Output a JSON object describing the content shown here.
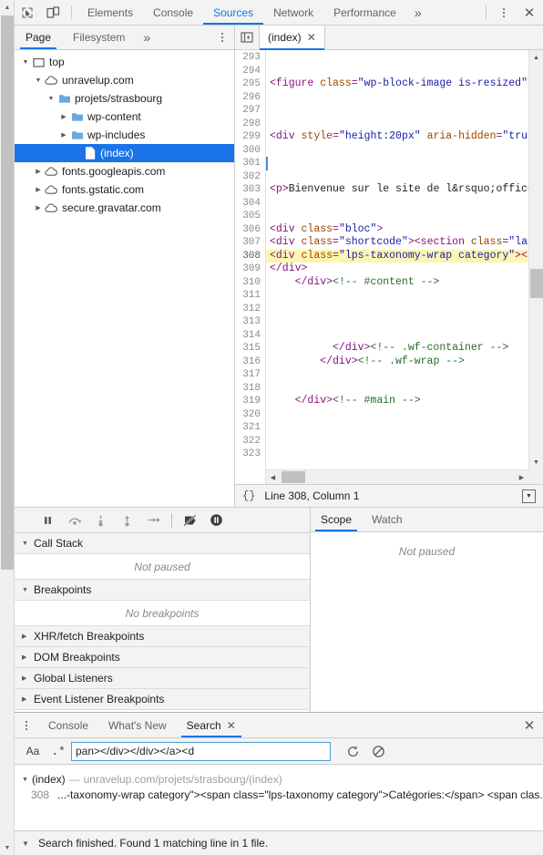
{
  "toolbar": {
    "inspect_icon": "inspect-cursor-icon",
    "device_icon": "device-toolbar-icon",
    "tabs": [
      {
        "label": "Elements",
        "active": false
      },
      {
        "label": "Console",
        "active": false
      },
      {
        "label": "Sources",
        "active": true
      },
      {
        "label": "Network",
        "active": false
      },
      {
        "label": "Performance",
        "active": false
      }
    ],
    "more_tabs": "»",
    "kebab_icon": "more-options-icon",
    "close_icon": "✕"
  },
  "navigator": {
    "tabs": [
      {
        "label": "Page",
        "active": true
      },
      {
        "label": "Filesystem",
        "active": false
      }
    ],
    "more": "»",
    "kebab_icon": "navigator-more-options-icon",
    "tree": [
      {
        "label": "top",
        "depth": 0,
        "icon": "frame-icon",
        "twisty": "down",
        "selected": false
      },
      {
        "label": "unravelup.com",
        "depth": 1,
        "icon": "cloud-icon",
        "twisty": "down",
        "selected": false
      },
      {
        "label": "projets/strasbourg",
        "depth": 2,
        "icon": "folder-icon",
        "twisty": "down",
        "selected": false
      },
      {
        "label": "wp-content",
        "depth": 3,
        "icon": "folder-icon",
        "twisty": "right",
        "selected": false
      },
      {
        "label": "wp-includes",
        "depth": 3,
        "icon": "folder-icon",
        "twisty": "right",
        "selected": false
      },
      {
        "label": "(index)",
        "depth": 4,
        "icon": "document-icon",
        "twisty": "none",
        "selected": true
      },
      {
        "label": "fonts.googleapis.com",
        "depth": 1,
        "icon": "cloud-icon",
        "twisty": "right",
        "selected": false
      },
      {
        "label": "fonts.gstatic.com",
        "depth": 1,
        "icon": "cloud-icon",
        "twisty": "right",
        "selected": false
      },
      {
        "label": "secure.gravatar.com",
        "depth": 1,
        "icon": "cloud-icon",
        "twisty": "right",
        "selected": false
      }
    ]
  },
  "editor": {
    "panel_toggle_icon": "show-navigator-icon",
    "tab_label": "(index)",
    "tab_close": "✕",
    "first_line": 293,
    "lines": [
      {
        "n": 293,
        "segments": []
      },
      {
        "n": 294,
        "segments": []
      },
      {
        "n": 295,
        "segments": [
          {
            "t": "tag",
            "s": "<figure "
          },
          {
            "t": "attr",
            "s": "class"
          },
          {
            "t": "tag",
            "s": "="
          },
          {
            "t": "val",
            "s": "\"wp-block-image is-resized\""
          },
          {
            "t": "tag",
            "s": "><img"
          }
        ]
      },
      {
        "n": 296,
        "segments": []
      },
      {
        "n": 297,
        "segments": []
      },
      {
        "n": 298,
        "segments": []
      },
      {
        "n": 299,
        "segments": [
          {
            "t": "tag",
            "s": "<div "
          },
          {
            "t": "attr",
            "s": "style"
          },
          {
            "t": "tag",
            "s": "="
          },
          {
            "t": "val",
            "s": "\"height:20px\""
          },
          {
            "t": "tag",
            "s": " "
          },
          {
            "t": "attr",
            "s": "aria-hidden"
          },
          {
            "t": "tag",
            "s": "="
          },
          {
            "t": "val",
            "s": "\"true\""
          },
          {
            "t": "tag",
            "s": " cl"
          }
        ]
      },
      {
        "n": 300,
        "segments": []
      },
      {
        "n": 301,
        "segments": []
      },
      {
        "n": 302,
        "segments": []
      },
      {
        "n": 303,
        "segments": [
          {
            "t": "tag",
            "s": "<p>"
          },
          {
            "t": "txt",
            "s": "Bienvenue sur le site de l&rsquo;office de"
          }
        ]
      },
      {
        "n": 304,
        "segments": []
      },
      {
        "n": 305,
        "segments": []
      },
      {
        "n": 306,
        "segments": [
          {
            "t": "tag",
            "s": "<div "
          },
          {
            "t": "attr",
            "s": "class"
          },
          {
            "t": "tag",
            "s": "="
          },
          {
            "t": "val",
            "s": "\"bloc\""
          },
          {
            "t": "tag",
            "s": ">"
          }
        ]
      },
      {
        "n": 307,
        "segments": [
          {
            "t": "tag",
            "s": "<div "
          },
          {
            "t": "attr",
            "s": "class"
          },
          {
            "t": "tag",
            "s": "="
          },
          {
            "t": "val",
            "s": "\"shortcode\""
          },
          {
            "t": "tag",
            "s": "><section "
          },
          {
            "t": "attr",
            "s": "class"
          },
          {
            "t": "tag",
            "s": "="
          },
          {
            "t": "val",
            "s": "\"latest-"
          }
        ]
      },
      {
        "n": 308,
        "highlight": true,
        "segments": [
          {
            "t": "tag",
            "s": "<div "
          },
          {
            "t": "attr",
            "s": "class"
          },
          {
            "t": "tag",
            "s": "="
          },
          {
            "t": "val",
            "s": "\"lps-taxonomy-wrap category\""
          },
          {
            "t": "tag",
            "s": "><span"
          }
        ]
      },
      {
        "n": 309,
        "segments": [
          {
            "t": "tag",
            "s": "</div>"
          }
        ]
      },
      {
        "n": 310,
        "segments": [
          {
            "t": "tag",
            "s": "    </div>"
          },
          {
            "t": "com",
            "s": "<!-- #content -->"
          }
        ]
      },
      {
        "n": 311,
        "segments": []
      },
      {
        "n": 312,
        "segments": []
      },
      {
        "n": 313,
        "segments": []
      },
      {
        "n": 314,
        "segments": []
      },
      {
        "n": 315,
        "segments": [
          {
            "t": "tag",
            "s": "          </div>"
          },
          {
            "t": "com",
            "s": "<!-- .wf-container -->"
          }
        ]
      },
      {
        "n": 316,
        "segments": [
          {
            "t": "tag",
            "s": "        </div>"
          },
          {
            "t": "com",
            "s": "<!-- .wf-wrap -->"
          }
        ]
      },
      {
        "n": 317,
        "segments": []
      },
      {
        "n": 318,
        "segments": []
      },
      {
        "n": 319,
        "segments": [
          {
            "t": "tag",
            "s": "    </div>"
          },
          {
            "t": "com",
            "s": "<!-- #main -->"
          }
        ]
      },
      {
        "n": 320,
        "segments": []
      },
      {
        "n": 321,
        "segments": []
      },
      {
        "n": 322,
        "segments": []
      },
      {
        "n": 323,
        "segments": []
      }
    ],
    "status": {
      "braces": "{}",
      "position": "Line 308, Column 1",
      "format_icon": "pretty-print-icon"
    }
  },
  "debugger": {
    "buttons": [
      {
        "name": "pause-script-execution",
        "icon": "pause-icon"
      },
      {
        "name": "step-over-next-function-call",
        "icon": "step-over-icon"
      },
      {
        "name": "step-into-next-function-call",
        "icon": "step-into-icon"
      },
      {
        "name": "step-out-of-current-function",
        "icon": "step-out-icon"
      },
      {
        "name": "step",
        "icon": "step-icon"
      },
      {
        "name": "deactivate-breakpoints",
        "icon": "deactivate-breakpoints-icon"
      },
      {
        "name": "pause-on-exceptions",
        "icon": "pause-on-exceptions-icon"
      }
    ],
    "sections": [
      {
        "title": "Call Stack",
        "expanded": true,
        "empty_text": "Not paused"
      },
      {
        "title": "Breakpoints",
        "expanded": true,
        "empty_text": "No breakpoints"
      },
      {
        "title": "XHR/fetch Breakpoints",
        "expanded": false,
        "empty_text": ""
      },
      {
        "title": "DOM Breakpoints",
        "expanded": false,
        "empty_text": ""
      },
      {
        "title": "Global Listeners",
        "expanded": false,
        "empty_text": ""
      },
      {
        "title": "Event Listener Breakpoints",
        "expanded": false,
        "empty_text": ""
      }
    ],
    "scope_tabs": [
      {
        "label": "Scope",
        "active": true
      },
      {
        "label": "Watch",
        "active": false
      }
    ],
    "scope_empty": "Not paused"
  },
  "drawer": {
    "kebab_icon": "drawer-more-options-icon",
    "tabs": [
      {
        "label": "Console",
        "active": false,
        "closable": false
      },
      {
        "label": "What's New",
        "active": false,
        "closable": false
      },
      {
        "label": "Search",
        "active": true,
        "closable": true
      }
    ],
    "tab_close": "✕",
    "close_icon": "✕",
    "search": {
      "match_case_label": "Aa",
      "regex_label": ".*",
      "query": "pan></div></div></a><d",
      "placeholder": "Search",
      "refresh_icon": "refresh-icon",
      "clear_icon": "clear-icon"
    },
    "results": {
      "file_caret": "▼",
      "file_name": "(index)",
      "dash": "—",
      "file_url": "unravelup.com/projets/strasbourg/(index)",
      "matches": [
        {
          "line": "308",
          "snippet": "...-taxonomy-wrap category\"><span class=\"lps-taxonomy category\">Catégories:</span> <span clas..."
        }
      ]
    }
  },
  "footer": {
    "caret": "▼",
    "message": "Search finished. Found 1 matching line in 1 file."
  },
  "colors": {
    "accent": "#1a73e8",
    "selection": "#1a73e8",
    "highlight": "#fdf6b2",
    "toolbar_bg": "#f3f3f3",
    "tag": "#881280",
    "attr": "#994500",
    "value": "#1a1aa6",
    "comment": "#236e25"
  }
}
